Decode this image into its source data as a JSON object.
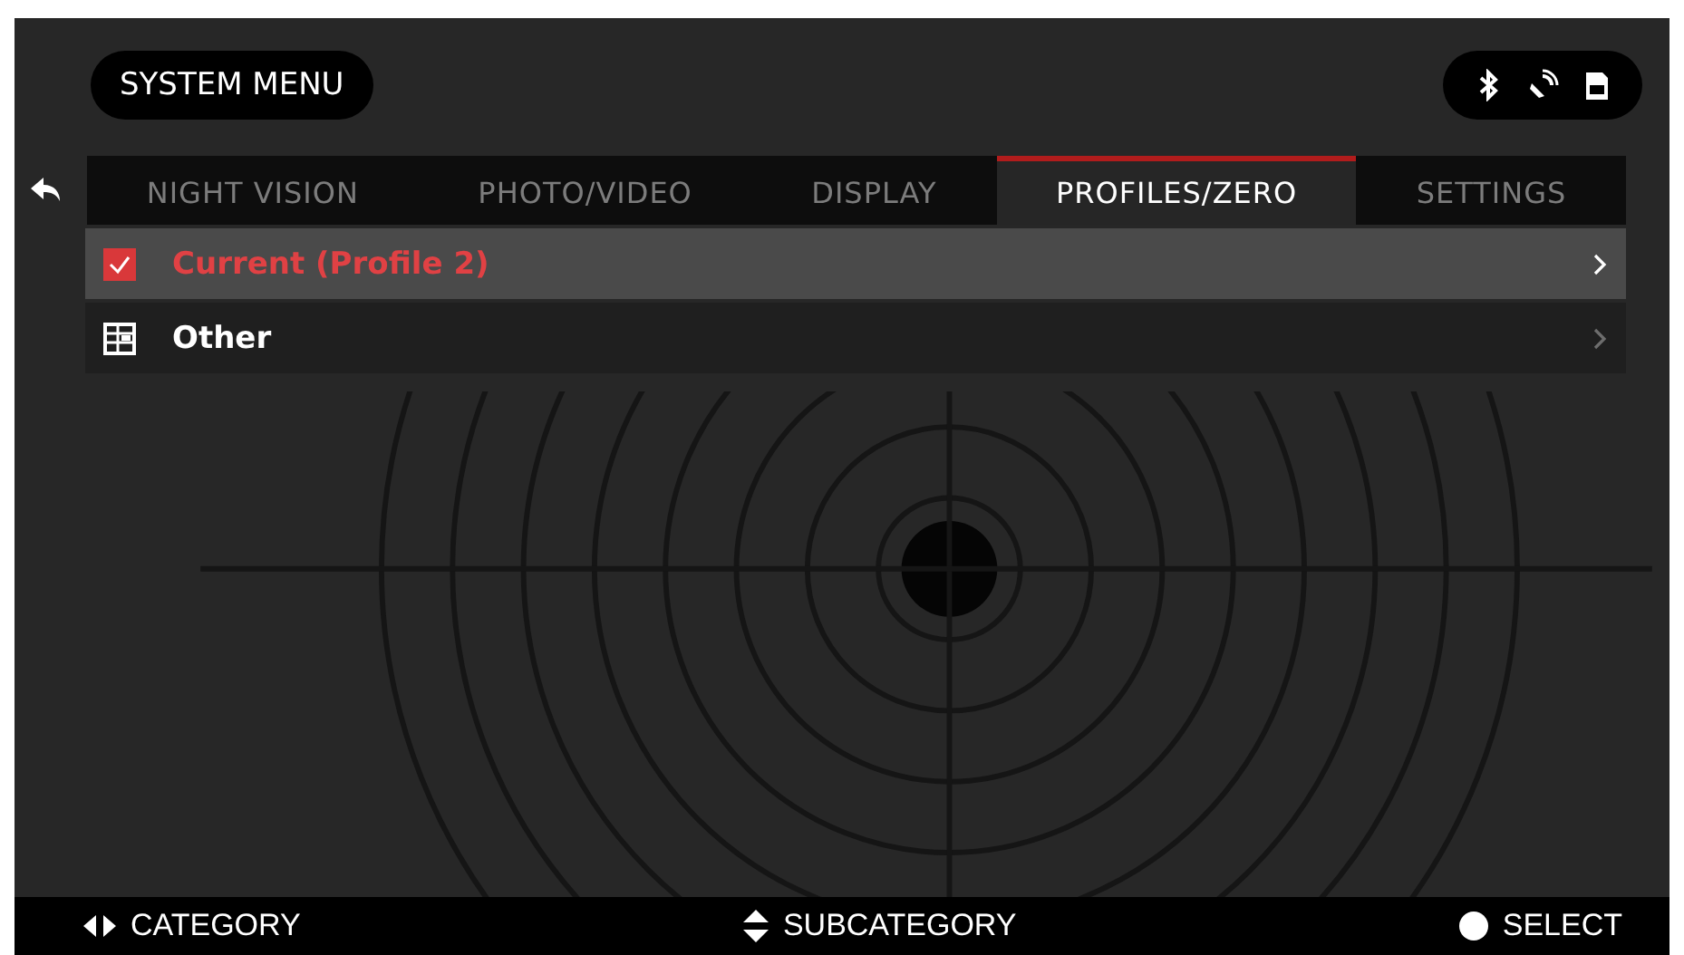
{
  "header": {
    "title": "SYSTEM MENU"
  },
  "tabs": [
    {
      "label": "NIGHT VISION",
      "selected": false
    },
    {
      "label": "PHOTO/VIDEO",
      "selected": false
    },
    {
      "label": "DISPLAY",
      "selected": false
    },
    {
      "label": "PROFILES/ZERO",
      "selected": true
    },
    {
      "label": "SETTINGS",
      "selected": false
    }
  ],
  "items": [
    {
      "kind": "checkbox",
      "label": "Current (Profile 2)",
      "selected": true
    },
    {
      "kind": "grid",
      "label": "Other",
      "selected": false
    }
  ],
  "footer": [
    {
      "kind": "left-right",
      "label": "CATEGORY"
    },
    {
      "kind": "up-down",
      "label": "SUBCATEGORY"
    },
    {
      "kind": "dot",
      "label": "SELECT"
    }
  ]
}
